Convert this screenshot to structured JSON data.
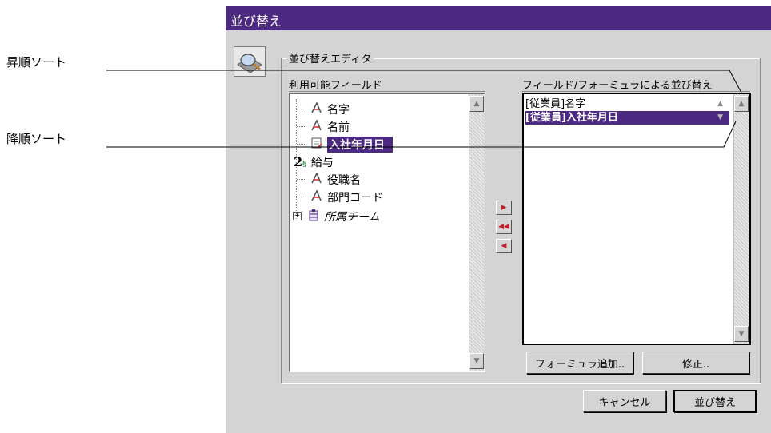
{
  "dialog": {
    "title": "並び替え",
    "group_title": "並び替えエディタ"
  },
  "callouts": {
    "ascending": "昇順ソート",
    "descending": "降順ソート"
  },
  "available_fields": {
    "label": "利用可能フィールド",
    "items": [
      {
        "label": "名字",
        "icon": "text-field-icon",
        "glyph": "A"
      },
      {
        "label": "名前",
        "icon": "text-field-icon",
        "glyph": "A"
      },
      {
        "label": "入社年月日",
        "icon": "date-field-icon",
        "glyph": "▤",
        "selected": true
      },
      {
        "label": "給与",
        "icon": "numeric-field-icon",
        "glyph": "2"
      },
      {
        "label": "役職名",
        "icon": "text-field-icon",
        "glyph": "A"
      },
      {
        "label": "部門コード",
        "icon": "text-field-icon",
        "glyph": "A"
      },
      {
        "label": "所属チーム",
        "icon": "table-icon",
        "glyph": "▥",
        "expand": "⊞"
      }
    ]
  },
  "sort_fields": {
    "label": "フィールド/フォーミュラによる並び替え",
    "items": [
      {
        "label": "[従業員]名字",
        "order": "ascending"
      },
      {
        "label": "[従業員]入社年月日",
        "order": "descending",
        "selected": true
      }
    ]
  },
  "transfer_buttons": [
    "add-arrow",
    "remove-all-arrow",
    "remove-arrow"
  ],
  "buttons": {
    "add_formula": "フォーミュラ追加..",
    "edit": "修正..",
    "cancel": "キャンセル",
    "sort": "並び替え"
  },
  "colors": {
    "accent": "#4c2a82",
    "dialog_bg": "#d4d4d4"
  }
}
